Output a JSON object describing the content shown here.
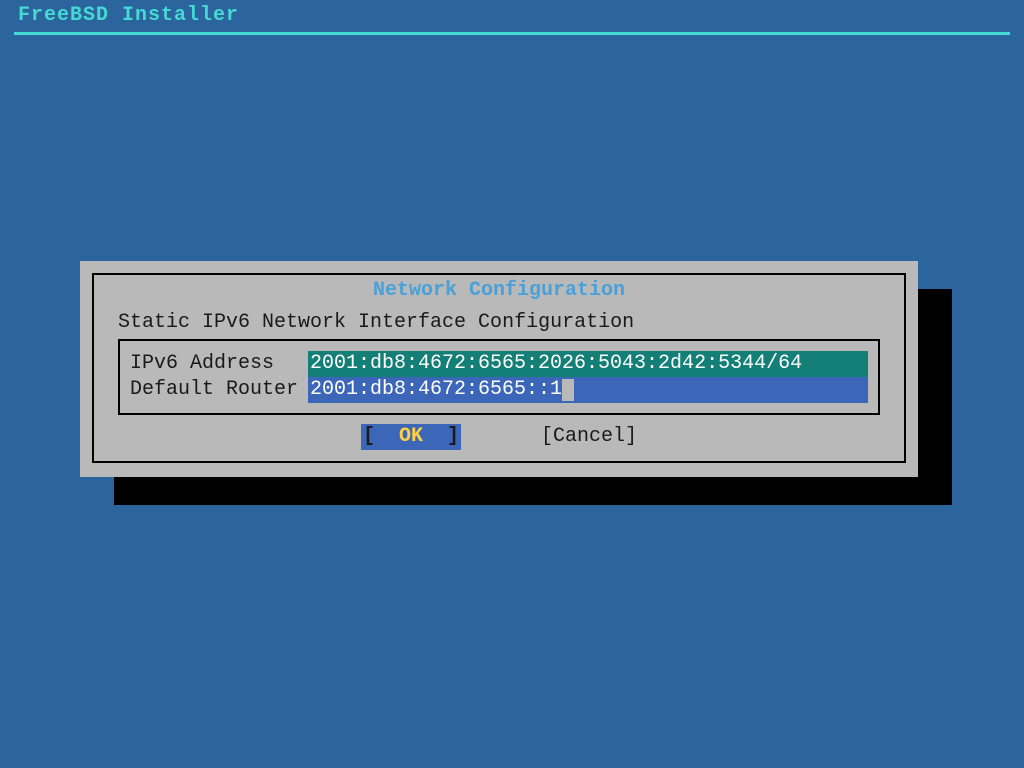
{
  "app": {
    "title": "FreeBSD Installer"
  },
  "dialog": {
    "frame_title": "Network Configuration",
    "subtitle": "Static IPv6 Network Interface Configuration",
    "fields": {
      "ipv6_address": {
        "label": "IPv6 Address",
        "value": "2001:db8:4672:6565:2026:5043:2d42:5344/64",
        "focused": false
      },
      "default_router": {
        "label": "Default Router",
        "value": "2001:db8:4672:6565::1",
        "focused": true
      }
    },
    "buttons": {
      "ok": "  OK  ",
      "cancel": "Cancel"
    }
  }
}
